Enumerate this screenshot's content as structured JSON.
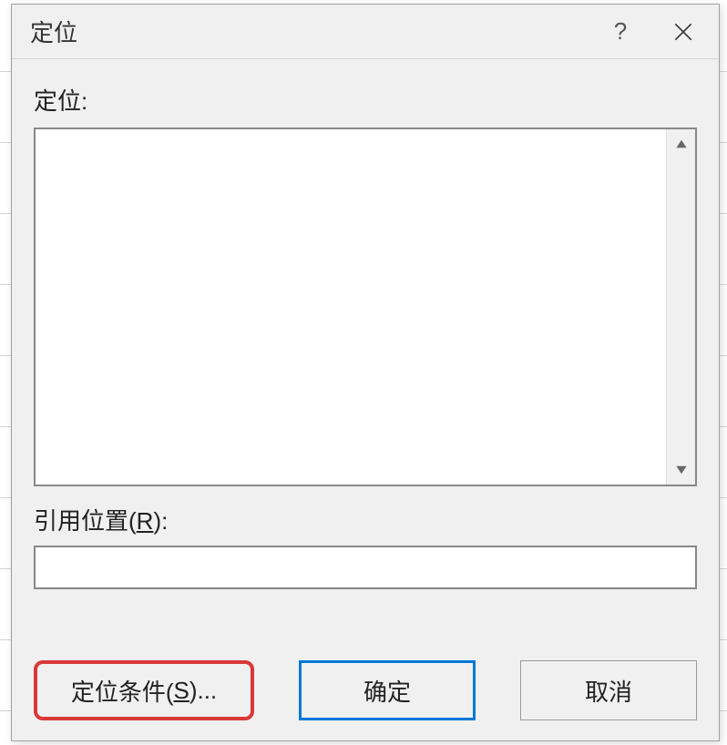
{
  "dialog": {
    "title": "定位",
    "goto_label": "定位:",
    "reference_label_prefix": "引用位置(",
    "reference_label_hotkey": "R",
    "reference_label_suffix": "):",
    "reference_value": "",
    "buttons": {
      "special_prefix": "定位条件(",
      "special_hotkey": "S",
      "special_suffix": ")...",
      "ok": "确定",
      "cancel": "取消"
    }
  }
}
